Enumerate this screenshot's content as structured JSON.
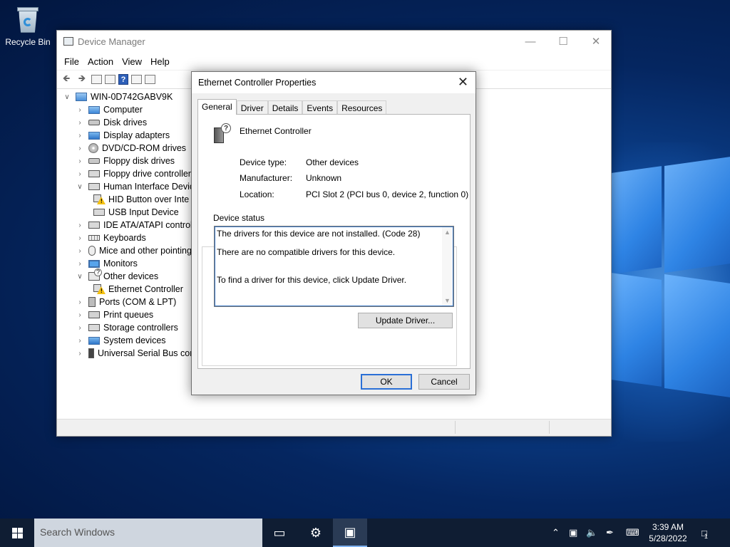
{
  "desktop": {
    "recycle_bin_label": "Recycle Bin"
  },
  "device_manager": {
    "title": "Device Manager",
    "menu": [
      "File",
      "Action",
      "View",
      "Help"
    ],
    "tree": {
      "root": "WIN-0D742GABV9K",
      "items": [
        {
          "label": "Computer",
          "icon": "computer-icon",
          "state": "collapsed"
        },
        {
          "label": "Disk drives",
          "icon": "disk-drive-icon",
          "state": "collapsed"
        },
        {
          "label": "Display adapters",
          "icon": "display-adapter-icon",
          "state": "collapsed"
        },
        {
          "label": "DVD/CD-ROM drives",
          "icon": "dvd-icon",
          "state": "collapsed"
        },
        {
          "label": "Floppy disk drives",
          "icon": "floppy-icon",
          "state": "collapsed"
        },
        {
          "label": "Floppy drive controllers",
          "icon": "controller-icon",
          "state": "collapsed"
        },
        {
          "label": "Human Interface Device",
          "icon": "hid-icon",
          "state": "expanded"
        },
        {
          "label": "HID Button over Inte",
          "icon": "warning-device-icon",
          "state": "child"
        },
        {
          "label": "USB Input Device",
          "icon": "hid-device-icon",
          "state": "child"
        },
        {
          "label": "IDE ATA/ATAPI controlle",
          "icon": "ide-icon",
          "state": "collapsed"
        },
        {
          "label": "Keyboards",
          "icon": "keyboard-icon",
          "state": "collapsed"
        },
        {
          "label": "Mice and other pointing",
          "icon": "mouse-icon",
          "state": "collapsed"
        },
        {
          "label": "Monitors",
          "icon": "monitor-icon",
          "state": "collapsed"
        },
        {
          "label": "Other devices",
          "icon": "unknown-device-icon",
          "state": "expanded"
        },
        {
          "label": "Ethernet Controller",
          "icon": "warning-device-icon",
          "state": "child"
        },
        {
          "label": "Ports (COM & LPT)",
          "icon": "port-icon",
          "state": "collapsed"
        },
        {
          "label": "Print queues",
          "icon": "printer-icon",
          "state": "collapsed"
        },
        {
          "label": "Storage controllers",
          "icon": "storage-icon",
          "state": "collapsed"
        },
        {
          "label": "System devices",
          "icon": "system-icon",
          "state": "collapsed"
        },
        {
          "label": "Universal Serial Bus con",
          "icon": "usb-icon",
          "state": "collapsed"
        }
      ]
    }
  },
  "dialog": {
    "title": "Ethernet Controller Properties",
    "tabs": [
      "General",
      "Driver",
      "Details",
      "Events",
      "Resources"
    ],
    "active_tab": "General",
    "device_name": "Ethernet Controller",
    "properties": [
      {
        "label": "Device type:",
        "value": "Other devices"
      },
      {
        "label": "Manufacturer:",
        "value": "Unknown"
      },
      {
        "label": "Location:",
        "value": "PCI Slot 2 (PCI bus 0, device 2, function 0)"
      }
    ],
    "device_status_label": "Device status",
    "status_lines": [
      "The drivers for this device are not installed. (Code 28)",
      "There are no compatible drivers for this device.",
      "To find a driver for this device, click Update Driver."
    ],
    "update_driver_label": "Update Driver...",
    "ok_label": "OK",
    "cancel_label": "Cancel"
  },
  "taskbar": {
    "search_placeholder": "Search Windows",
    "time": "3:39 AM",
    "date": "5/28/2022",
    "notification_count": "1"
  },
  "colors": {
    "accent": "#2a6fd6",
    "taskbar": "#0f1d33",
    "warning": "#f5c211"
  }
}
